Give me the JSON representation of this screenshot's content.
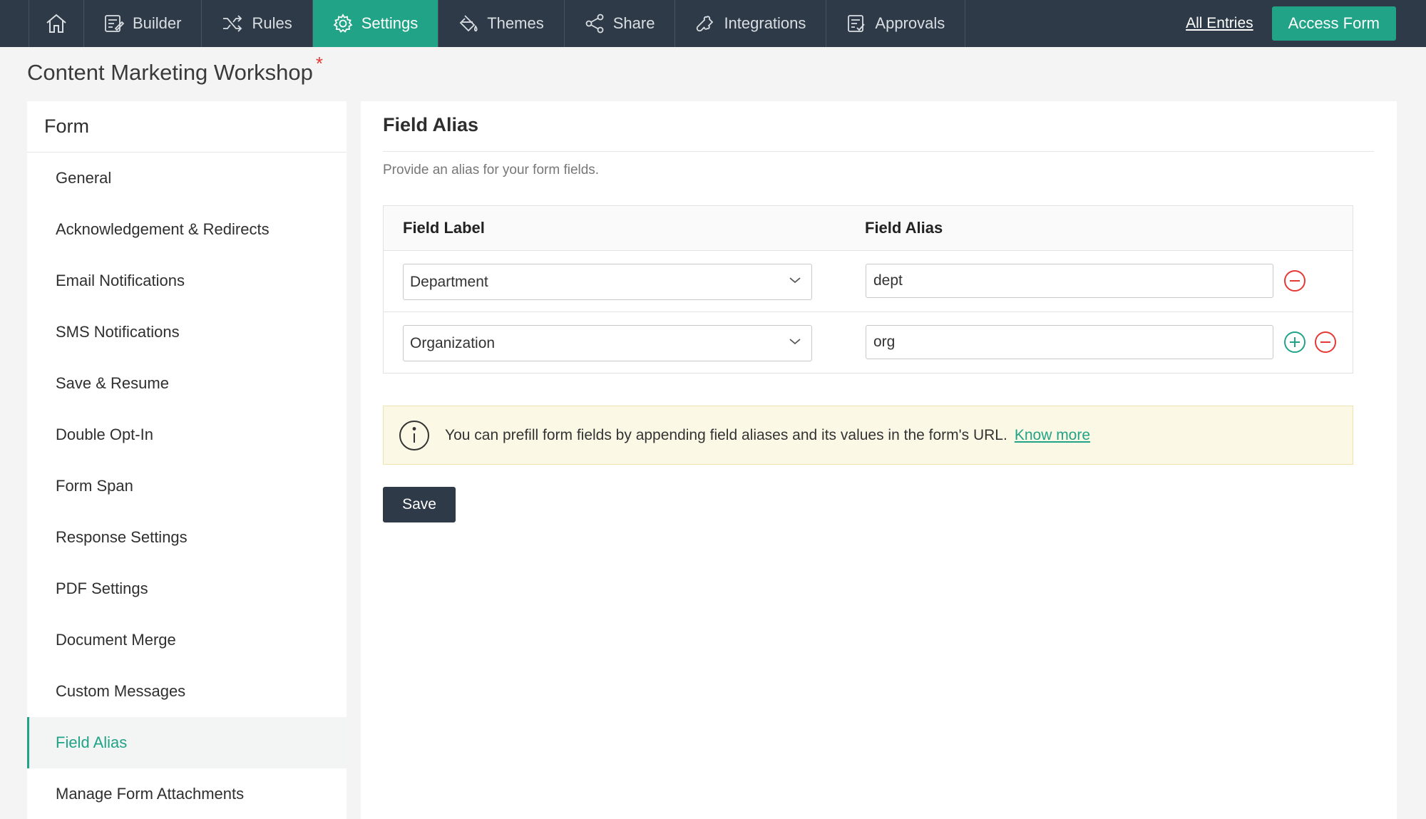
{
  "nav": {
    "tabs": [
      {
        "label": "Builder",
        "icon": "builder-icon"
      },
      {
        "label": "Rules",
        "icon": "shuffle-icon"
      },
      {
        "label": "Settings",
        "icon": "gear-icon"
      },
      {
        "label": "Themes",
        "icon": "paint-bucket-icon"
      },
      {
        "label": "Share",
        "icon": "share-icon"
      },
      {
        "label": "Integrations",
        "icon": "puzzle-icon"
      },
      {
        "label": "Approvals",
        "icon": "approvals-icon"
      }
    ],
    "active_tab": "Settings",
    "all_entries": "All Entries",
    "access_form": "Access Form"
  },
  "page": {
    "title": "Content Marketing Workshop",
    "required_mark": "*"
  },
  "sidebar": {
    "heading": "Form",
    "items": [
      {
        "label": "General"
      },
      {
        "label": "Acknowledgement & Redirects"
      },
      {
        "label": "Email Notifications"
      },
      {
        "label": "SMS Notifications"
      },
      {
        "label": "Save & Resume"
      },
      {
        "label": "Double Opt-In"
      },
      {
        "label": "Form Span"
      },
      {
        "label": "Response Settings"
      },
      {
        "label": "PDF Settings"
      },
      {
        "label": "Document Merge"
      },
      {
        "label": "Custom Messages"
      },
      {
        "label": "Field Alias"
      },
      {
        "label": "Manage Form Attachments"
      }
    ],
    "active_item": "Field Alias"
  },
  "main": {
    "title": "Field Alias",
    "description": "Provide an alias for your form fields.",
    "table": {
      "headers": {
        "label": "Field Label",
        "alias": "Field Alias"
      },
      "rows": [
        {
          "field": "Department",
          "alias": "dept"
        },
        {
          "field": "Organization",
          "alias": "org"
        }
      ]
    },
    "info": {
      "text": "You can prefill form fields by appending field aliases and its values in the form's URL.",
      "link": "Know more"
    },
    "save_label": "Save"
  },
  "colors": {
    "accent": "#20a386",
    "nav_bg": "#2e3a47",
    "remove": "#e53935",
    "info_bg": "#fcf8e6"
  }
}
